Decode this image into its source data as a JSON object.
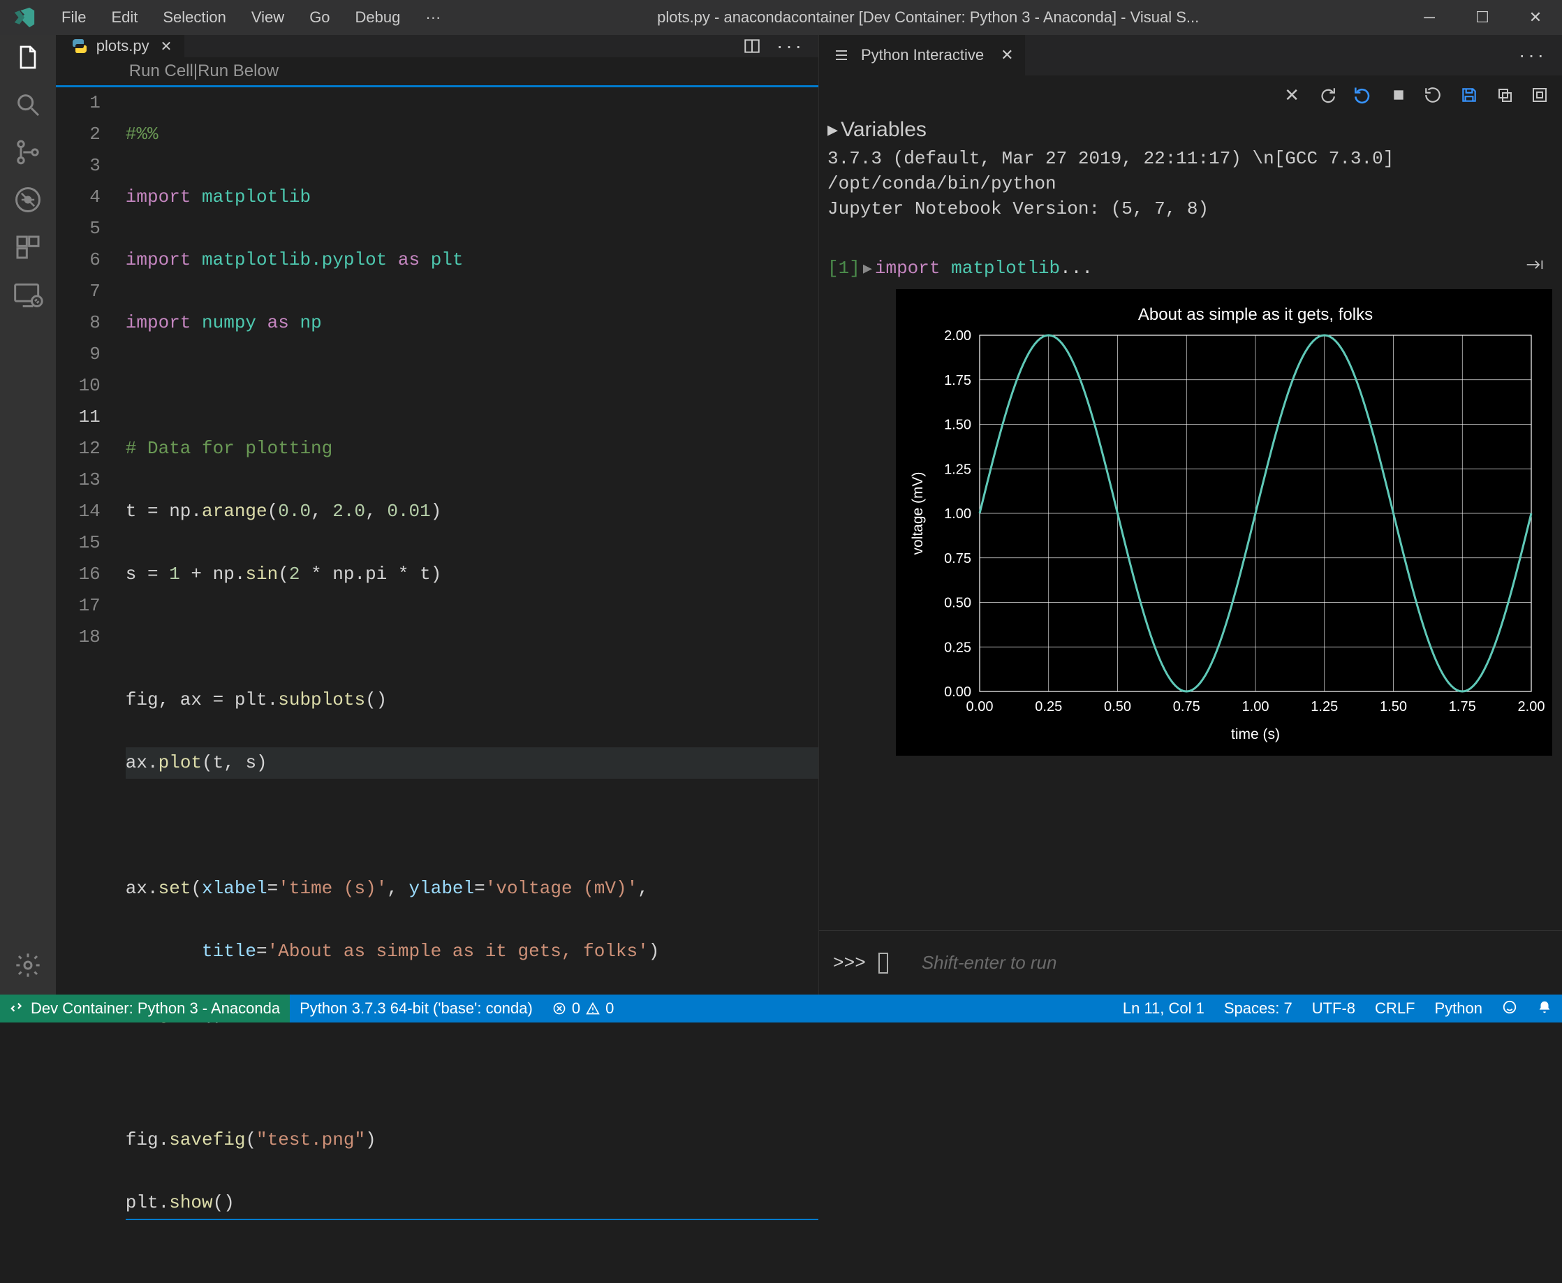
{
  "menubar": {
    "file": "File",
    "edit": "Edit",
    "selection": "Selection",
    "view": "View",
    "go": "Go",
    "debug": "Debug",
    "more": "···"
  },
  "window_title": "plots.py - anacondacontainer [Dev Container: Python 3 - Anaconda] - Visual S...",
  "editor_tab": {
    "filename": "plots.py"
  },
  "codelens": {
    "run_cell": "Run Cell",
    "sep": " | ",
    "run_below": "Run Below"
  },
  "code": {
    "l1": "#%%",
    "l2a": "import",
    "l2b": " matplotlib",
    "l3a": "import",
    "l3b": " matplotlib.pyplot ",
    "l3c": "as",
    "l3d": " plt",
    "l4a": "import",
    "l4b": " numpy ",
    "l4c": "as",
    "l4d": " np",
    "l5": "",
    "l6": "# Data for plotting",
    "l7a": "t = np.",
    "l7b": "arange",
    "l7c": "(",
    "l7d": "0.0",
    "l7e": ", ",
    "l7f": "2.0",
    "l7g": ", ",
    "l7h": "0.01",
    "l7i": ")",
    "l8a": "s = ",
    "l8b": "1",
    "l8c": " + np.",
    "l8d": "sin",
    "l8e": "(",
    "l8f": "2",
    "l8g": " * np.pi * t)",
    "l9": "",
    "l10a": "fig, ax = plt.",
    "l10b": "subplots",
    "l10c": "()",
    "l11a": "ax.",
    "l11b": "plot",
    "l11c": "(t, s)",
    "l12": "",
    "l13a": "ax.",
    "l13b": "set",
    "l13c": "(",
    "l13d": "xlabel",
    "l13e": "=",
    "l13f": "'time (s)'",
    "l13g": ", ",
    "l13h": "ylabel",
    "l13i": "=",
    "l13j": "'voltage (mV)'",
    "l13k": ",",
    "l14a": "       ",
    "l14b": "title",
    "l14c": "=",
    "l14d": "'About as simple as it gets, folks'",
    "l14e": ")",
    "l15a": "ax.",
    "l15b": "grid",
    "l15c": "()",
    "l16": "",
    "l17a": "fig.",
    "l17b": "savefig",
    "l17c": "(",
    "l17d": "\"test.png\"",
    "l17e": ")",
    "l18a": "plt.",
    "l18b": "show",
    "l18c": "()"
  },
  "line_numbers": [
    "1",
    "2",
    "3",
    "4",
    "5",
    "6",
    "7",
    "8",
    "9",
    "10",
    "11",
    "12",
    "13",
    "14",
    "15",
    "16",
    "17",
    "18"
  ],
  "interactive": {
    "title": "Python Interactive",
    "variables_label": "Variables",
    "sysinfo": "3.7.3 (default, Mar 27 2019, 22:11:17) \\n[GCC 7.3.0]\n/opt/conda/bin/python\nJupyter Notebook Version: (5, 7, 8)",
    "cell_num": "[1]",
    "cell_toggle": "▸",
    "cell_code_kw": "import",
    "cell_code_sp": " ",
    "cell_code_mod": "matplotlib",
    "cell_code_tail": "...",
    "prompt": ">>>",
    "hint": "Shift-enter to run"
  },
  "chart_data": {
    "type": "line",
    "title": "About as simple as it gets, folks",
    "xlabel": "time (s)",
    "ylabel": "voltage (mV)",
    "xlim": [
      0.0,
      2.0
    ],
    "ylim": [
      0.0,
      2.0
    ],
    "xticks": [
      0.0,
      0.25,
      0.5,
      0.75,
      1.0,
      1.25,
      1.5,
      1.75,
      2.0
    ],
    "yticks": [
      0.0,
      0.25,
      0.5,
      0.75,
      1.0,
      1.25,
      1.5,
      1.75,
      2.0
    ],
    "series": [
      {
        "name": "voltage",
        "formula": "1 + sin(2*pi*t)",
        "x_step": 0.01
      }
    ],
    "grid": true,
    "line_color": "#5fc9b8",
    "bg": "#000000",
    "fg": "#ffffff"
  },
  "statusbar": {
    "remote": "Dev Container: Python 3 - Anaconda",
    "interpreter": "Python 3.7.3 64-bit ('base': conda)",
    "errors": "0",
    "warnings": "0",
    "cursor": "Ln 11, Col 1",
    "spaces": "Spaces: 7",
    "encoding": "UTF-8",
    "eol": "CRLF",
    "lang": "Python"
  }
}
